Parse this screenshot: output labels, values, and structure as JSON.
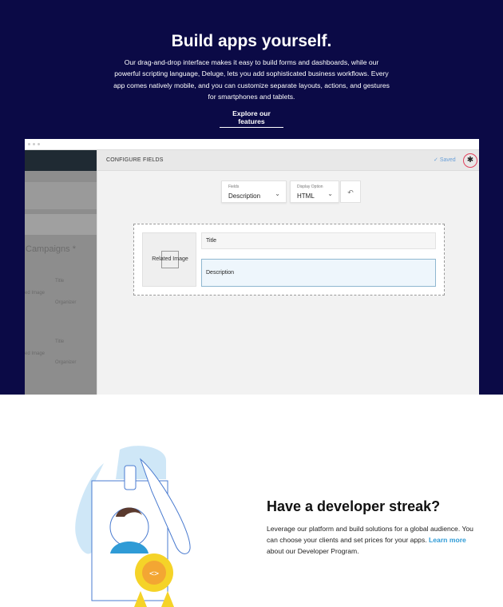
{
  "hero": {
    "title": "Build apps yourself.",
    "description": "Our drag-and-drop interface makes it easy to build forms and dashboards, while our powerful scripting language, Deluge, lets you add sophisticated business workflows. Every app comes natively mobile, and you can customize separate layouts, actions, and gestures for smartphones and tablets.",
    "link_label": "Explore our features"
  },
  "screenshot": {
    "left_panel": {
      "heading": "Campaigns *",
      "rows": [
        {
          "image_label": "ed Image",
          "title_label": "Title",
          "organizer_label": "Organizer"
        },
        {
          "image_label": "ed Image",
          "title_label": "Title",
          "organizer_label": "Organizer"
        }
      ]
    },
    "header": {
      "title": "CONFIGURE FIELDS",
      "saved_label": "Saved",
      "bug_icon": "bug-icon"
    },
    "fields_select": {
      "label": "Fields",
      "value": "Description"
    },
    "display_select": {
      "label": "Display Option",
      "value": "HTML"
    },
    "canvas": {
      "image_label": "Related Image",
      "title_label": "Title",
      "description_label": "Description"
    }
  },
  "developer": {
    "title": "Have a developer streak?",
    "text_before": "Leverage our platform and build solutions for a global audience. You can choose your clients and set prices for your apps.",
    "link_label": "Learn more",
    "text_after": "about our Developer Program."
  },
  "colors": {
    "hero_bg": "#0b0a46",
    "link_blue": "#2f9bd6",
    "badge_yellow": "#f5d328",
    "illustration_blue": "#cfe7f7"
  }
}
